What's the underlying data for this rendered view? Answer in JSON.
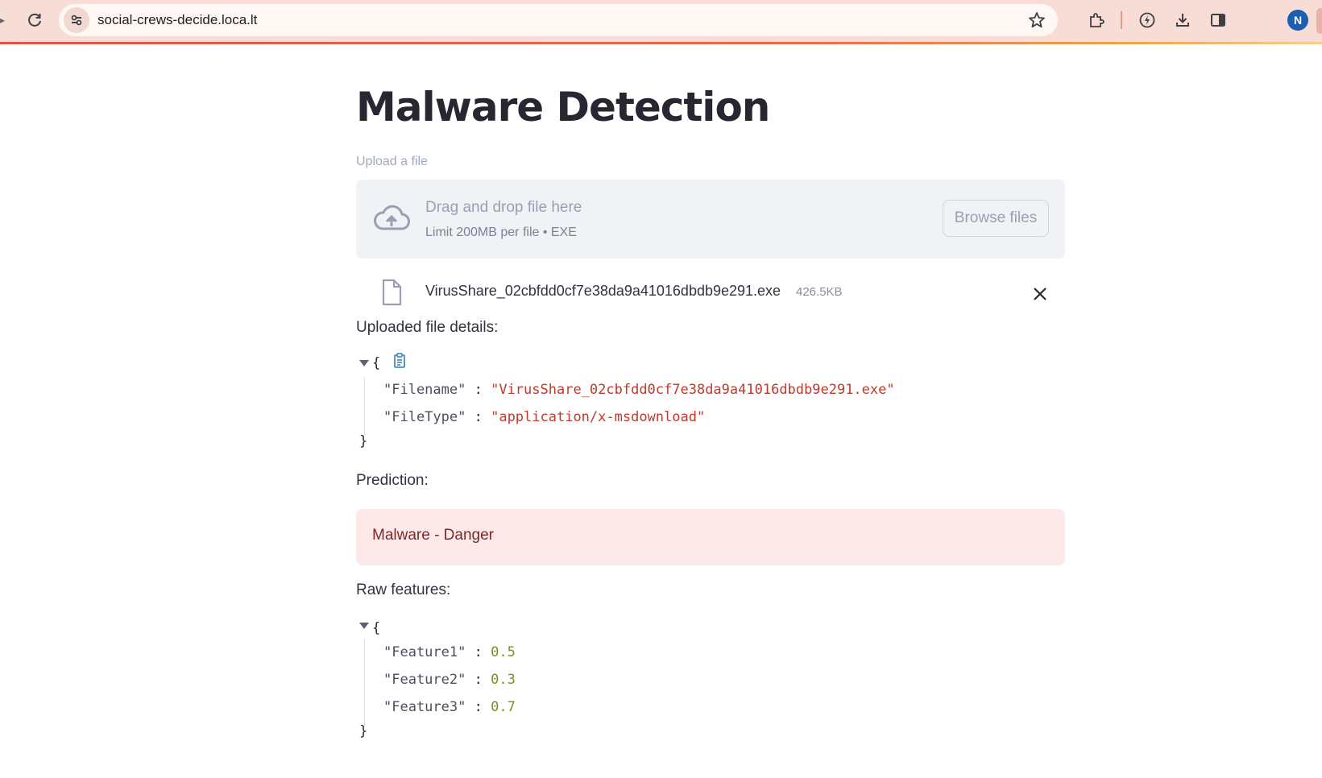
{
  "browser": {
    "url": "social-crews-decide.loca.lt",
    "profile_initial": "N"
  },
  "app": {
    "title": "Malware Detection",
    "uploader": {
      "label": "Upload a file",
      "drop_text": "Drag and drop file here",
      "limit_text": "Limit 200MB per file • EXE",
      "browse_label": "Browse files"
    },
    "uploaded_file": {
      "name": "VirusShare_02cbfdd0cf7e38da9a41016dbdb9e291.exe",
      "size": "426.5KB"
    },
    "details_label": "Uploaded file details:",
    "details_json": {
      "open_brace": "{",
      "close_brace": "}",
      "rows": [
        {
          "key": "\"Filename\"",
          "value": "\"VirusShare_02cbfdd0cf7e38da9a41016dbdb9e291.exe\""
        },
        {
          "key": "\"FileType\"",
          "value": "\"application/x-msdownload\""
        }
      ]
    },
    "prediction_label": "Prediction:",
    "prediction_text": "Malware - Danger",
    "raw_label": "Raw features:",
    "raw_json": {
      "open_brace": "{",
      "close_brace": "}",
      "rows": [
        {
          "key": "\"Feature1\"",
          "value": "0.5"
        },
        {
          "key": "\"Feature2\"",
          "value": "0.3"
        },
        {
          "key": "\"Feature3\"",
          "value": "0.7"
        }
      ]
    }
  },
  "colors": {
    "chrome_bg": "#f7ddd6",
    "error_bg": "#fde9ea",
    "json_string": "#c0392b",
    "json_number": "#7a8f1f"
  },
  "icons": [
    "reload-icon",
    "site-info-icon",
    "star-icon",
    "extensions-icon",
    "performance-icon",
    "download-icon",
    "side-panel-icon",
    "cloud-upload-icon",
    "file-icon",
    "close-icon",
    "caret-down-icon",
    "copy-icon"
  ]
}
